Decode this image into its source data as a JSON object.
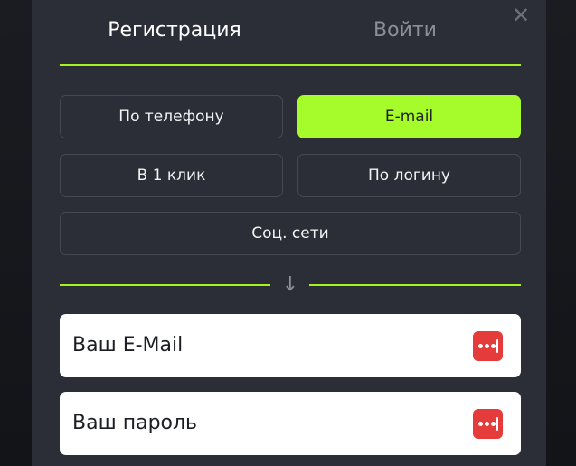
{
  "modal": {
    "close_glyph": "✕",
    "tabs": {
      "register": "Регистрация",
      "login": "Войти"
    }
  },
  "methods": {
    "phone": "По телефону",
    "email": "E-mail",
    "one_click": "В 1 клик",
    "by_login": "По логину",
    "social": "Соц. сети"
  },
  "divider": {
    "arrow_glyph": "↓"
  },
  "form": {
    "email_placeholder": "Ваш E-Mail",
    "password_placeholder": "Ваш пароль",
    "icons": {
      "email_field_icon": "password-manager-icon",
      "password_field_icon": "password-manager-icon"
    }
  },
  "colors": {
    "accent": "#a6fb2a",
    "modal_bg": "#2b2e36",
    "icon_red": "#e53b3a"
  },
  "selected_method": "email"
}
